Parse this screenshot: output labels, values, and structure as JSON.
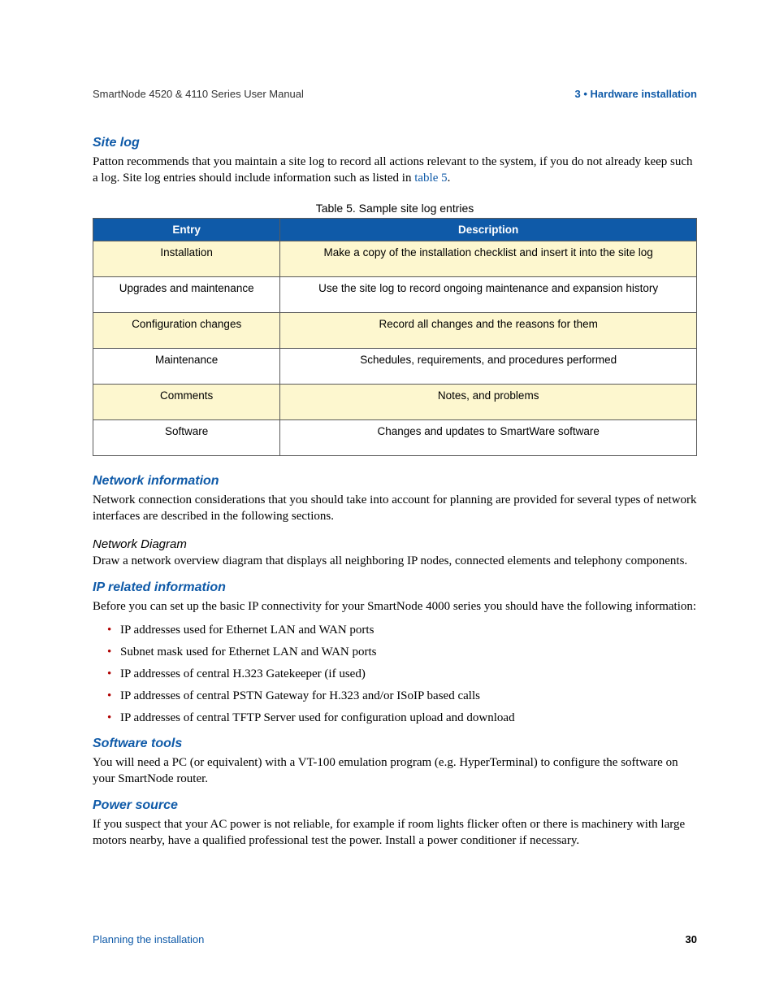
{
  "header": {
    "left": "SmartNode 4520 & 4110 Series User Manual",
    "right": "3 • Hardware installation"
  },
  "sections": {
    "site_log": {
      "title": "Site log",
      "para_pre": "Patton recommends that you maintain a site log to record all actions relevant to the system, if you do not already keep such a log. Site log entries should include information such as listed in ",
      "para_link": "table 5",
      "para_post": "."
    },
    "table_caption": "Table 5. Sample site log entries",
    "network_info": {
      "title": "Network information",
      "para": "Network connection considerations that you should take into account for planning are provided for several types of network interfaces are described in the following sections."
    },
    "network_diagram": {
      "title": "Network Diagram",
      "para": "Draw a network overview diagram that displays all neighboring IP nodes, connected elements and telephony components."
    },
    "ip_info": {
      "title": "IP related information",
      "para": "Before you can set up the basic IP connectivity for your SmartNode 4000 series you should have the following information:",
      "items": [
        "IP addresses used for Ethernet LAN and WAN ports",
        "Subnet mask used for Ethernet LAN and WAN ports",
        "IP addresses of central H.323 Gatekeeper (if used)",
        "IP addresses of central PSTN Gateway for H.323 and/or ISoIP based calls",
        "IP addresses of central TFTP Server used for configuration upload and download"
      ]
    },
    "software_tools": {
      "title": "Software tools",
      "para": "You will need a PC (or equivalent) with a VT-100 emulation program (e.g. HyperTerminal) to configure the software on your SmartNode router."
    },
    "power_source": {
      "title": "Power source",
      "para": "If you suspect that your AC power is not reliable, for example if room lights flicker often or there is machinery with large motors nearby, have a qualified professional test the power. Install a power conditioner if necessary."
    }
  },
  "chart_data": {
    "type": "table",
    "title": "Table 5. Sample site log entries",
    "columns": [
      "Entry",
      "Description"
    ],
    "rows": [
      {
        "entry": "Installation",
        "description": "Make a copy of the installation checklist and insert it into the site log"
      },
      {
        "entry": "Upgrades and maintenance",
        "description": "Use the site log to record ongoing maintenance and expansion history"
      },
      {
        "entry": "Configuration changes",
        "description": "Record all changes and the reasons for them"
      },
      {
        "entry": "Maintenance",
        "description": "Schedules, requirements, and procedures performed"
      },
      {
        "entry": "Comments",
        "description": "Notes, and problems"
      },
      {
        "entry": "Software",
        "description": "Changes and updates to SmartWare software"
      }
    ]
  },
  "footer": {
    "left": "Planning the installation",
    "right": "30"
  }
}
